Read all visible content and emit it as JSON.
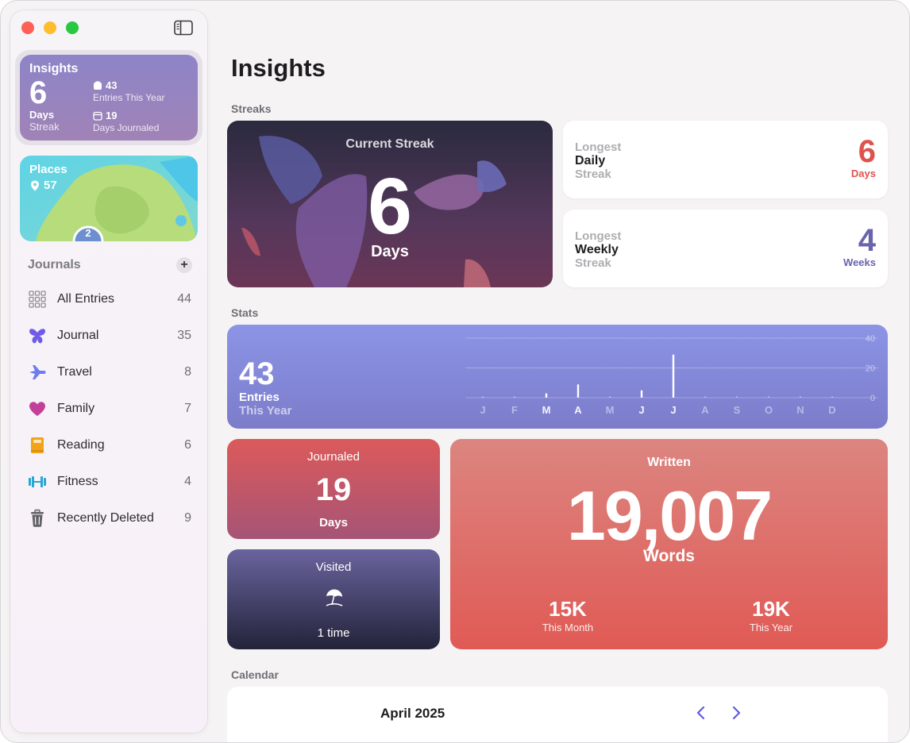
{
  "window": {
    "traffic_lights": [
      "close",
      "minimize",
      "zoom"
    ]
  },
  "sidebar": {
    "insights_card": {
      "title": "Insights",
      "streak_value": "6",
      "streak_unit": "Days",
      "streak_label": "Streak",
      "entries_count": "43",
      "entries_label": "Entries This Year",
      "days_count": "19",
      "days_label": "Days Journaled"
    },
    "places_card": {
      "title": "Places",
      "count": "57",
      "cluster_count": "2"
    },
    "journals_header": "Journals",
    "add_label": "+",
    "journals": [
      {
        "label": "All Entries",
        "count": "44",
        "icon": "grid-icon",
        "color": "#8e8e93"
      },
      {
        "label": "Journal",
        "count": "35",
        "icon": "butterfly-icon",
        "color": "#6e5ce6"
      },
      {
        "label": "Travel",
        "count": "8",
        "icon": "airplane-icon",
        "color": "#6d7cf0"
      },
      {
        "label": "Family",
        "count": "7",
        "icon": "heart-icon",
        "color": "#c2409a"
      },
      {
        "label": "Reading",
        "count": "6",
        "icon": "book-icon",
        "color": "#f2a31b"
      },
      {
        "label": "Fitness",
        "count": "4",
        "icon": "dumbbell-icon",
        "color": "#24a6d8"
      },
      {
        "label": "Recently Deleted",
        "count": "9",
        "icon": "trash-icon",
        "color": "#636366"
      }
    ]
  },
  "main": {
    "title": "Insights",
    "streaks_header": "Streaks",
    "current_streak": {
      "label": "Current Streak",
      "value": "6",
      "unit": "Days"
    },
    "longest_daily": {
      "line1": "Longest",
      "line2": "Daily",
      "line3": "Streak",
      "value": "6",
      "unit": "Days",
      "color": "#e0524c"
    },
    "longest_weekly": {
      "line1": "Longest",
      "line2": "Weekly",
      "line3": "Streak",
      "value": "4",
      "unit": "Weeks",
      "color": "#6a64ad"
    },
    "stats_header": "Stats",
    "entries": {
      "value": "43",
      "line1": "Entries",
      "line2": "This Year"
    },
    "journaled": {
      "label": "Journaled",
      "value": "19",
      "unit": "Days"
    },
    "visited": {
      "label": "Visited",
      "icon": "beach-umbrella-icon",
      "value": "1 time"
    },
    "written": {
      "label": "Written",
      "value": "19,007",
      "unit": "Words",
      "month_value": "15K",
      "month_label": "This Month",
      "year_value": "19K",
      "year_label": "This Year"
    },
    "calendar_header": "Calendar",
    "calendar": {
      "month": "April 2025",
      "accent": "#5e5ce6"
    }
  },
  "chart_data": {
    "type": "bar",
    "categories": [
      "J",
      "F",
      "M",
      "A",
      "M",
      "J",
      "J",
      "A",
      "S",
      "O",
      "N",
      "D"
    ],
    "values": [
      0,
      0,
      3,
      9,
      0,
      5,
      29,
      0,
      0,
      0,
      0,
      0
    ],
    "ylim": [
      0,
      40
    ],
    "yticks": [
      "40",
      "20",
      "0"
    ],
    "grid": true,
    "highlighted_months": [
      2,
      3,
      5,
      6
    ]
  }
}
